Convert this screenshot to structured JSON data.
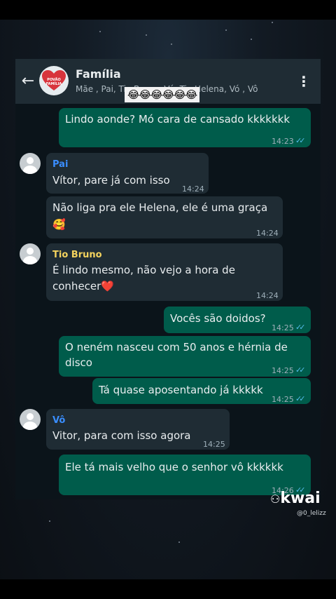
{
  "header": {
    "title": "Família",
    "subtitle": "Mãe , Pai, Tio Bruno, Vó, Tia Helena, Vó , Vô",
    "avatar_text": "POVÃO FAMÍLIA",
    "emoji_strip": "😂😂😂😂😂😂"
  },
  "messages": [
    {
      "dir": "out",
      "text": "Lindo aonde? Mó cara de cansado kkkkkkk",
      "time": "14:23"
    },
    {
      "dir": "in",
      "sender": "Pai",
      "sender_color": "#3a8eff",
      "text": "Vítor, pare já com isso",
      "time": "14:24"
    },
    {
      "dir": "in",
      "text_line1": "Não liga pra ele Helena, ele é uma graça",
      "text_line2": "🥰",
      "time": "14:24"
    },
    {
      "dir": "in",
      "sender": "Tio Bruno",
      "sender_color": "#f4d35e",
      "text_line1": "É lindo mesmo, não vejo a hora de",
      "text_line2": "conhecer❤️",
      "time": "14:24"
    },
    {
      "dir": "out",
      "text": "Vocês são doidos?",
      "time": "14:25"
    },
    {
      "dir": "out",
      "text_line1": "O neném nasceu com 50 anos e hérnia de",
      "text_line2": "disco",
      "time": "14:25"
    },
    {
      "dir": "out",
      "text": "Tá quase aposentando já kkkkk",
      "time": "14:25"
    },
    {
      "dir": "in",
      "sender": "Vô",
      "sender_color": "#3a8eff",
      "text": "Vitor, para com isso agora",
      "time": "14:25"
    },
    {
      "dir": "out",
      "text": "Ele tá mais velho que o senhor vô kkkkkk",
      "time": "14:26"
    }
  ],
  "ticks": "✓✓",
  "watermark": {
    "logo": "kwai",
    "handle": "@0_lelizz"
  },
  "colors": {
    "outgoing": "#005c4b",
    "incoming": "#1f2c34",
    "header": "#1f2c34",
    "chat_bg": "#0b141a"
  }
}
